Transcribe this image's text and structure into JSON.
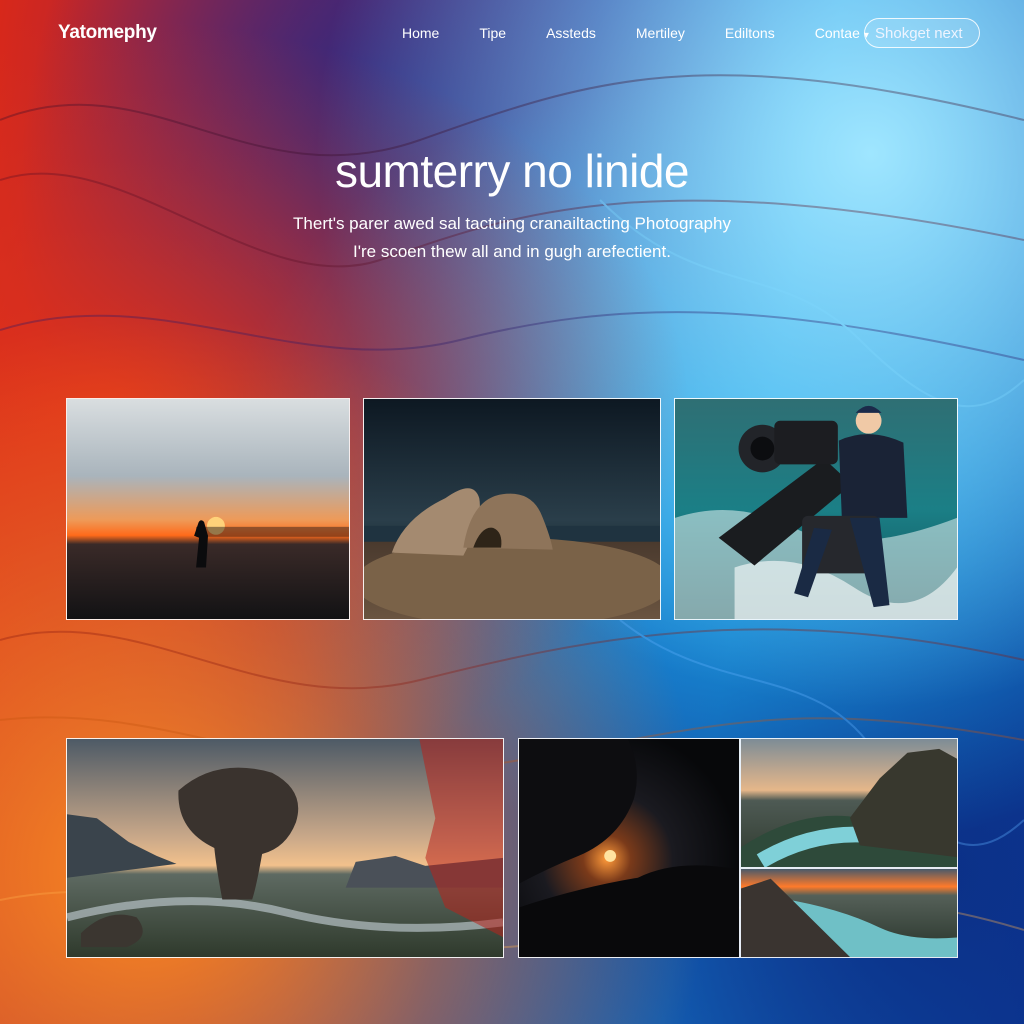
{
  "brand": {
    "logo_text": "Yatomephy"
  },
  "nav": {
    "links": [
      "Home",
      "Tipe",
      "Assteds",
      "Mertiley",
      "Ediltons",
      "Contae"
    ],
    "search_placeholder": "Shokget next"
  },
  "hero": {
    "title": "sumterry no linide",
    "subtitle_line1": "Thert's parer awed sal tactuing cranailtacting Photography",
    "subtitle_line2": "I're scoen thew all and in gugh arefectient."
  },
  "gallery": {
    "items": [
      {
        "icon": "sunset-silhouette-photo"
      },
      {
        "icon": "boulder-beach-photo"
      },
      {
        "icon": "photographer-camera-waves-photo"
      },
      {
        "icon": "balanced-rock-landscape-photo"
      },
      {
        "icon": "dark-rock-sunset-photo"
      },
      {
        "icon": "river-cliff-photo"
      },
      {
        "icon": "river-valley-sunset-photo"
      }
    ]
  },
  "colors": {
    "accent_red": "#e0321a",
    "accent_orange": "#ff8a1e",
    "accent_blue": "#1aa8ec",
    "deep_blue": "#0b2f86",
    "text": "#ffffff"
  }
}
